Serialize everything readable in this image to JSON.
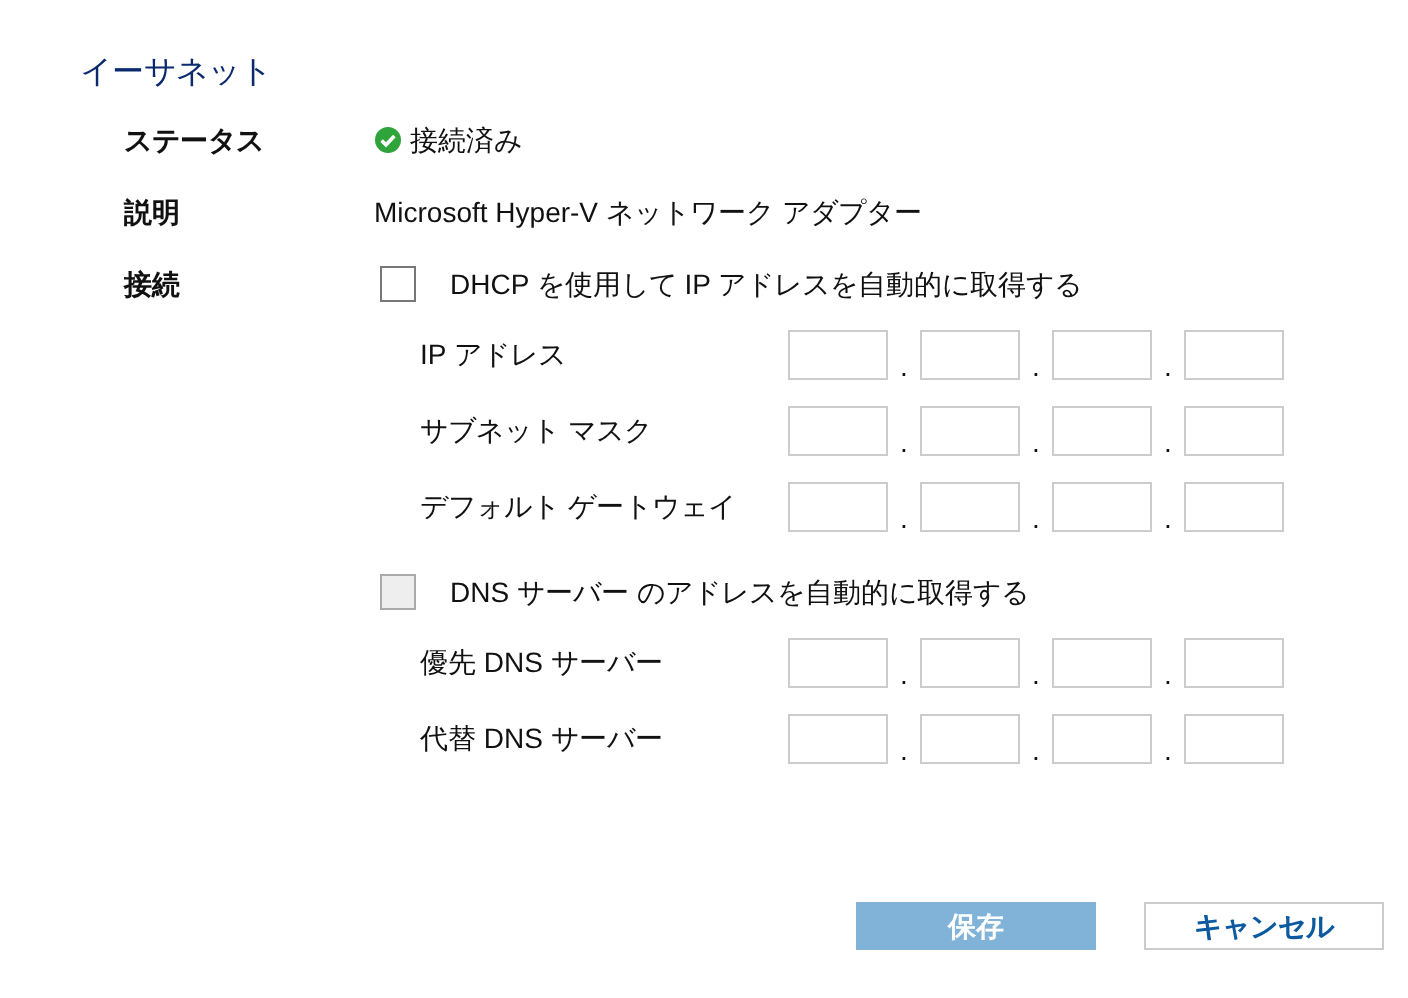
{
  "title": "イーサネット",
  "status": {
    "label": "ステータス",
    "value": "接続済み",
    "connected": true
  },
  "description": {
    "label": "説明",
    "value": "Microsoft Hyper-V ネットワーク アダプター"
  },
  "connection": {
    "label": "接続",
    "groups": [
      {
        "checkbox": {
          "label": "DHCP を使用して IP アドレスを自動的に取得する",
          "checked": false,
          "disabled": false
        },
        "addresses": [
          {
            "label": "IP アドレス",
            "separators": [
              ".",
              ".",
              "."
            ]
          },
          {
            "label": "サブネット マスク",
            "separators": [
              ".",
              ".",
              "."
            ]
          },
          {
            "label": "デフォルト ゲートウェイ",
            "separators": [
              ".",
              ".",
              "."
            ]
          }
        ]
      },
      {
        "checkbox": {
          "label": "DNS サーバー のアドレスを自動的に取得する",
          "checked": false,
          "disabled": true
        },
        "addresses": [
          {
            "label": "優先 DNS サーバー",
            "separators": [
              ".",
              ".",
              "."
            ]
          },
          {
            "label": "代替 DNS サーバー",
            "separators": [
              ".",
              ".",
              "."
            ]
          }
        ]
      }
    ]
  },
  "buttons": [
    {
      "label": "保存",
      "kind": "primary",
      "disabled": true
    },
    {
      "label": "キャンセル",
      "kind": "secondary",
      "disabled": false
    }
  ]
}
